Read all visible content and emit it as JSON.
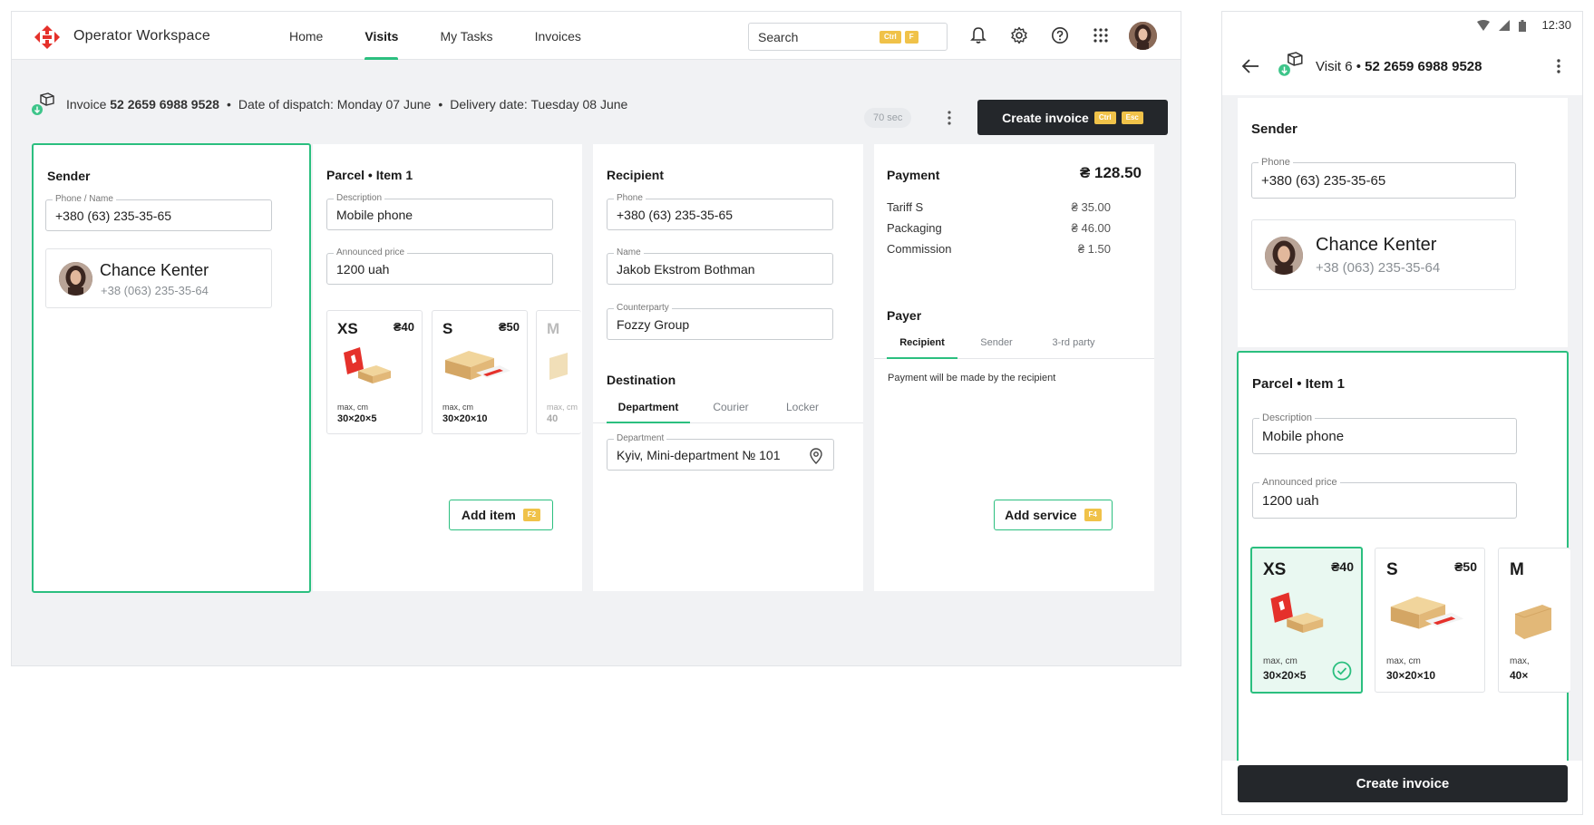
{
  "app": {
    "title": "Operator Workspace"
  },
  "nav": {
    "items": [
      "Home",
      "Visits",
      "My Tasks",
      "Invoices"
    ],
    "active": "Visits"
  },
  "search": {
    "placeholder": "Search",
    "shortcut1": "Ctrl",
    "shortcut2": "F"
  },
  "icons": [
    "bell-icon",
    "gear-icon",
    "help-icon",
    "apps-grid-icon"
  ],
  "invoice_bar": {
    "label": "Invoice",
    "number": "52 2659 6988 9528",
    "dispatch": "Date of dispatch: Monday 07 June",
    "delivery": "Delivery date: Tuesday 08 June",
    "timer": "70 sec",
    "create_button": "Create invoice",
    "create_kbd1": "Ctrl",
    "create_kbd2": "Esc"
  },
  "sender": {
    "title": "Sender",
    "phone_label": "Phone / Name",
    "phone_value": "+380 (63) 235-35-65",
    "contact_name": "Chance Kenter",
    "contact_phone": "+38 (063) 235-35-64"
  },
  "parcel": {
    "title": "Parcel • Item 1",
    "description_label": "Description",
    "description_value": "Mobile phone",
    "price_label": "Announced price",
    "price_value": "1200 uah",
    "sizes": [
      {
        "size": "XS",
        "price": "₴40",
        "max": "max, cm",
        "dims": "30×20×5"
      },
      {
        "size": "S",
        "price": "₴50",
        "max": "max, cm",
        "dims": "30×20×10"
      },
      {
        "size": "M",
        "price": "",
        "max": "max, cm",
        "dims": "40"
      }
    ],
    "add_item": "Add item",
    "add_item_kbd": "F2"
  },
  "recipient": {
    "title": "Recipient",
    "phone_label": "Phone",
    "phone_value": "+380 (63) 235-35-65",
    "name_label": "Name",
    "name_value": "Jakob Ekstrom Bothman",
    "counterparty_label": "Counterparty",
    "counterparty_value": "Fozzy Group",
    "destination_title": "Destination",
    "destination_tabs": [
      "Department",
      "Courier",
      "Locker"
    ],
    "department_label": "Department",
    "department_value": "Kyiv, Mini-department № 101"
  },
  "payment": {
    "title": "Payment",
    "total": "₴ 128.50",
    "lines": [
      {
        "label": "Tariff S",
        "amount": "₴ 35.00"
      },
      {
        "label": "Packaging",
        "amount": "₴ 46.00"
      },
      {
        "label": "Commission",
        "amount": "₴ 1.50"
      }
    ],
    "payer_title": "Payer",
    "payer_tabs": [
      "Recipient",
      "Sender",
      "3-rd party"
    ],
    "note": "Payment will be made by the recipient",
    "add_service": "Add service",
    "add_service_kbd": "F4"
  },
  "mobile": {
    "time": "12:30",
    "visit_label": "Visit 6 •",
    "visit_number": "52 2659 6988 9528",
    "sender_title": "Sender",
    "phone_label": "Phone",
    "phone_value": "+380 (63) 235-35-65",
    "contact_name": "Chance Kenter",
    "contact_phone": "+38 (063) 235-35-64",
    "parcel_title": "Parcel • Item 1",
    "description_label": "Description",
    "description_value": "Mobile phone",
    "price_label": "Announced price",
    "price_value": "1200 uah",
    "sizes": [
      {
        "size": "XS",
        "price": "₴40",
        "max": "max, cm",
        "dims": "30×20×5"
      },
      {
        "size": "S",
        "price": "₴50",
        "max": "max, cm",
        "dims": "30×20×10"
      },
      {
        "size": "M",
        "price": "",
        "max": "max,",
        "dims": "40×"
      }
    ],
    "create_button": "Create invoice"
  },
  "colors": {
    "accent": "#2bbf7f",
    "dark": "#24272b",
    "kbd": "#f0c249",
    "brand_red": "#e5312b"
  }
}
